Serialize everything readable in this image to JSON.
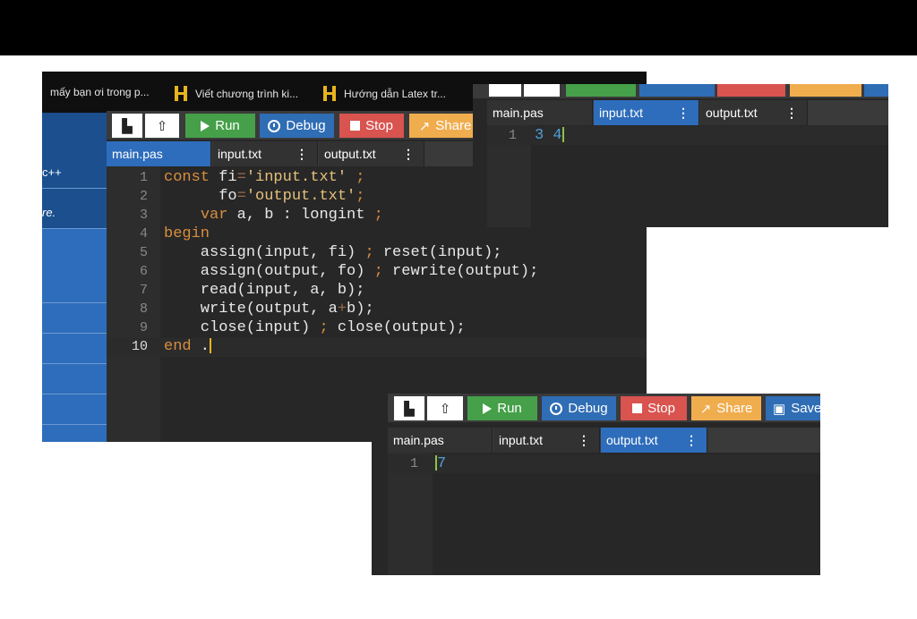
{
  "bookmarks": [
    {
      "label": "mấy bạn ơi trong p...",
      "icon": "none"
    },
    {
      "label": "Viết chương trình ki...",
      "icon": "bookmark-h-icon"
    },
    {
      "label": "Hướng dẫn Latex tr...",
      "icon": "bookmark-h-icon"
    }
  ],
  "sidebar": {
    "items": [
      "c++",
      "re."
    ]
  },
  "toolbar": {
    "run": "Run",
    "debug": "Debug",
    "stop": "Stop",
    "share": "Share",
    "save": "Save",
    "new_file_icon": "new-file-icon",
    "upload_icon": "upload-icon"
  },
  "tabs": {
    "main": "main.pas",
    "input": "input.txt",
    "output": "output.txt"
  },
  "editor": {
    "line_numbers": [
      "1",
      "2",
      "3",
      "4",
      "5",
      "6",
      "7",
      "8",
      "9",
      "10"
    ],
    "lines": [
      "const fi='input.txt' ;",
      "      fo='output.txt';",
      "    var a, b : longint ;",
      "begin",
      "    assign(input, fi) ; reset(input);",
      "    assign(output, fo) ; rewrite(output);",
      "    read(input, a, b);",
      "    write(output, a+b);",
      "    close(input) ; close(output);",
      "end ."
    ]
  },
  "input_file": {
    "line_numbers": [
      "1"
    ],
    "content": "3 4"
  },
  "output_file": {
    "line_numbers": [
      "1"
    ],
    "content": "7"
  },
  "colors": {
    "run": "#45a049",
    "debug": "#2f6db5",
    "stop": "#d9534f",
    "share": "#f0ad4e",
    "active_tab": "#2e6dbb"
  }
}
